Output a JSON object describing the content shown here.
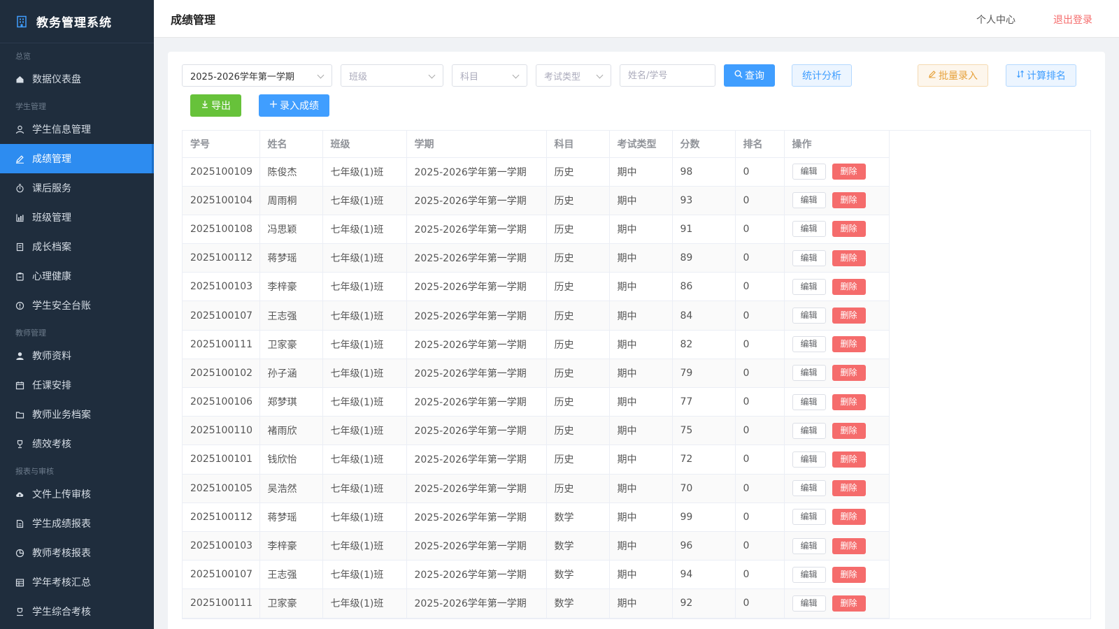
{
  "brand": {
    "title": "教务管理系统"
  },
  "sidebar": {
    "groups": [
      {
        "title": "总览",
        "items": [
          {
            "label": "数据仪表盘",
            "icon": "home-icon"
          }
        ]
      },
      {
        "title": "学生管理",
        "items": [
          {
            "label": "学生信息管理",
            "icon": "user-icon"
          },
          {
            "label": "成绩管理",
            "icon": "edit-icon"
          },
          {
            "label": "课后服务",
            "icon": "timer-icon"
          },
          {
            "label": "班级管理",
            "icon": "chart-icon"
          },
          {
            "label": "成长档案",
            "icon": "notebook-icon"
          },
          {
            "label": "心理健康",
            "icon": "clipboard-icon"
          },
          {
            "label": "学生安全台账",
            "icon": "warning-icon"
          }
        ]
      },
      {
        "title": "教师管理",
        "items": [
          {
            "label": "教师资料",
            "icon": "person-icon"
          },
          {
            "label": "任课安排",
            "icon": "calendar-icon"
          },
          {
            "label": "教师业务档案",
            "icon": "folder-icon"
          },
          {
            "label": "绩效考核",
            "icon": "trophy-icon"
          }
        ]
      },
      {
        "title": "报表与审核",
        "items": [
          {
            "label": "文件上传审核",
            "icon": "upload-icon"
          },
          {
            "label": "学生成绩报表",
            "icon": "document-icon"
          },
          {
            "label": "教师考核报表",
            "icon": "pie-icon"
          },
          {
            "label": "学年考核汇总",
            "icon": "table-icon"
          },
          {
            "label": "学生综合考核",
            "icon": "award-icon"
          }
        ]
      }
    ],
    "active": "成绩管理"
  },
  "header": {
    "title": "成绩管理",
    "personal_center": "个人中心",
    "logout": "退出登录"
  },
  "filters": {
    "semester": "2025-2026学年第一学期",
    "class_placeholder": "班级",
    "subject_placeholder": "科目",
    "exam_type_placeholder": "考试类型",
    "search_placeholder": "姓名/学号"
  },
  "buttons": {
    "query": "查询",
    "stats": "统计分析",
    "batch_entry": "批量录入",
    "calc_rank": "计算排名",
    "export": "导出",
    "enter_score": "录入成绩"
  },
  "table": {
    "columns": [
      "学号",
      "姓名",
      "班级",
      "学期",
      "科目",
      "考试类型",
      "分数",
      "排名",
      "操作"
    ],
    "edit_label": "编辑",
    "delete_label": "删除",
    "rows": [
      [
        "2025100109",
        "陈俊杰",
        "七年级(1)班",
        "2025-2026学年第一学期",
        "历史",
        "期中",
        "98",
        "0"
      ],
      [
        "2025100104",
        "周雨桐",
        "七年级(1)班",
        "2025-2026学年第一学期",
        "历史",
        "期中",
        "93",
        "0"
      ],
      [
        "2025100108",
        "冯思颖",
        "七年级(1)班",
        "2025-2026学年第一学期",
        "历史",
        "期中",
        "91",
        "0"
      ],
      [
        "2025100112",
        "蒋梦瑶",
        "七年级(1)班",
        "2025-2026学年第一学期",
        "历史",
        "期中",
        "89",
        "0"
      ],
      [
        "2025100103",
        "李梓豪",
        "七年级(1)班",
        "2025-2026学年第一学期",
        "历史",
        "期中",
        "86",
        "0"
      ],
      [
        "2025100107",
        "王志强",
        "七年级(1)班",
        "2025-2026学年第一学期",
        "历史",
        "期中",
        "84",
        "0"
      ],
      [
        "2025100111",
        "卫家豪",
        "七年级(1)班",
        "2025-2026学年第一学期",
        "历史",
        "期中",
        "82",
        "0"
      ],
      [
        "2025100102",
        "孙子涵",
        "七年级(1)班",
        "2025-2026学年第一学期",
        "历史",
        "期中",
        "79",
        "0"
      ],
      [
        "2025100106",
        "郑梦琪",
        "七年级(1)班",
        "2025-2026学年第一学期",
        "历史",
        "期中",
        "77",
        "0"
      ],
      [
        "2025100110",
        "褚雨欣",
        "七年级(1)班",
        "2025-2026学年第一学期",
        "历史",
        "期中",
        "75",
        "0"
      ],
      [
        "2025100101",
        "钱欣怡",
        "七年级(1)班",
        "2025-2026学年第一学期",
        "历史",
        "期中",
        "72",
        "0"
      ],
      [
        "2025100105",
        "吴浩然",
        "七年级(1)班",
        "2025-2026学年第一学期",
        "历史",
        "期中",
        "70",
        "0"
      ],
      [
        "2025100112",
        "蒋梦瑶",
        "七年级(1)班",
        "2025-2026学年第一学期",
        "数学",
        "期中",
        "99",
        "0"
      ],
      [
        "2025100103",
        "李梓豪",
        "七年级(1)班",
        "2025-2026学年第一学期",
        "数学",
        "期中",
        "96",
        "0"
      ],
      [
        "2025100107",
        "王志强",
        "七年级(1)班",
        "2025-2026学年第一学期",
        "数学",
        "期中",
        "94",
        "0"
      ],
      [
        "2025100111",
        "卫家豪",
        "七年级(1)班",
        "2025-2026学年第一学期",
        "数学",
        "期中",
        "92",
        "0"
      ]
    ]
  }
}
